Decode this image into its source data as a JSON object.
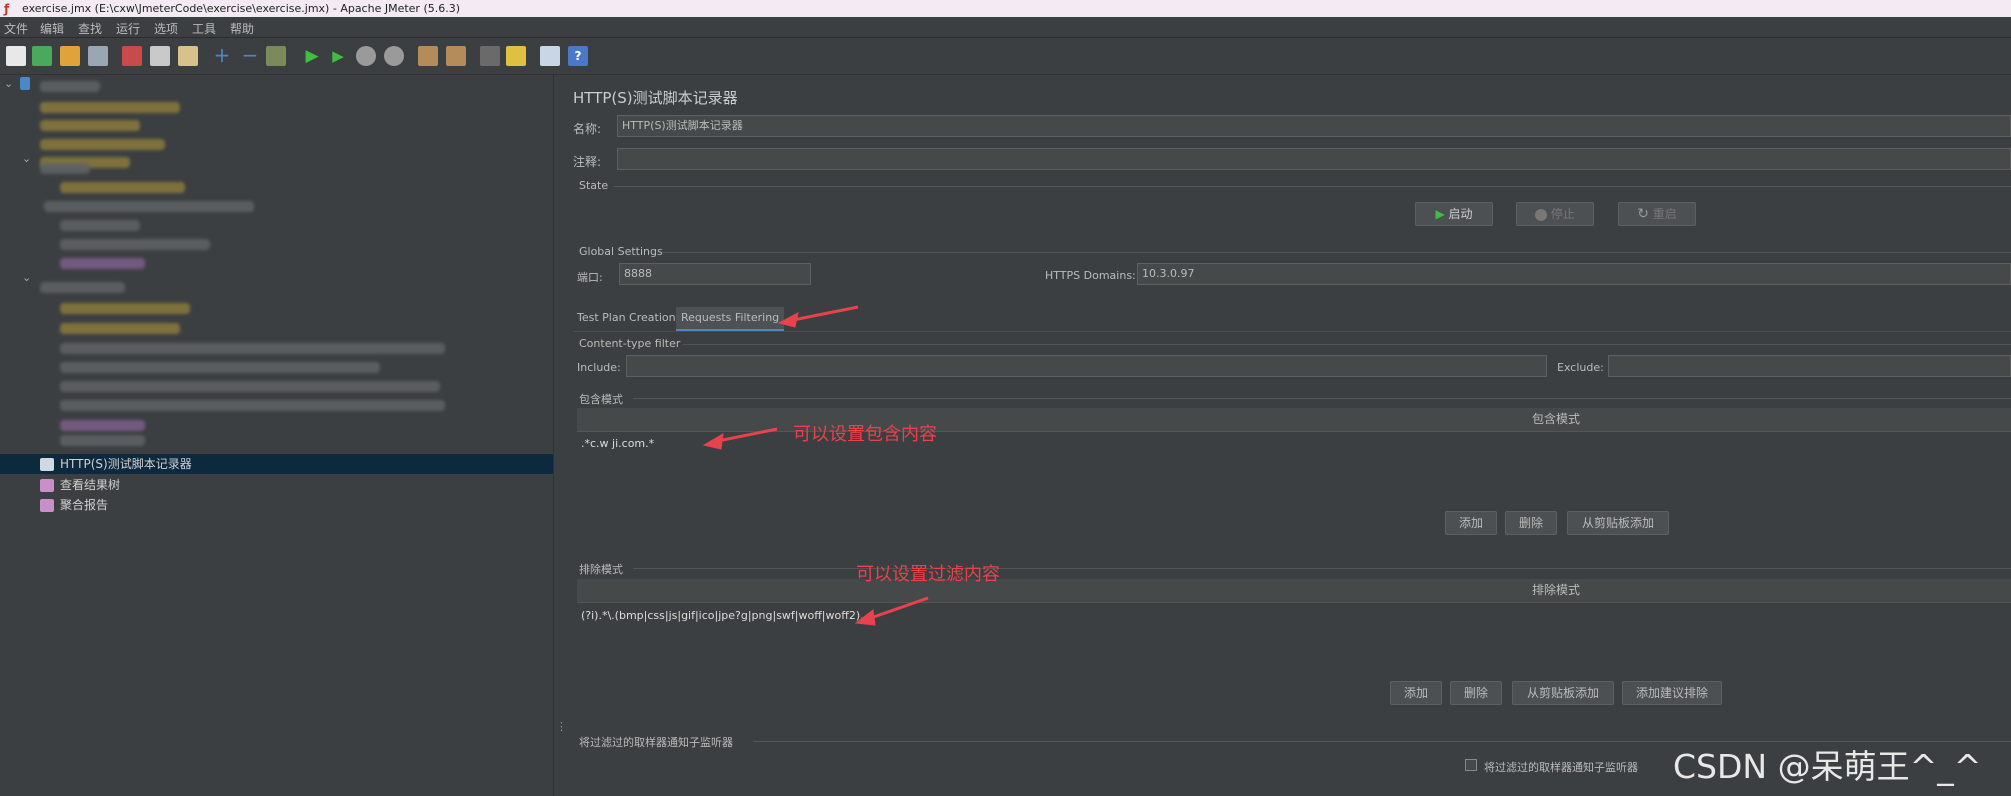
{
  "window": {
    "title": "exercise.jmx (E:\\cxw\\JmeterCode\\exercise\\exercise.jmx) - Apache JMeter (5.6.3)"
  },
  "menu": [
    "文件",
    "编辑",
    "查找",
    "运行",
    "选项",
    "工具",
    "帮助"
  ],
  "tree": {
    "items": [
      {
        "label": "HTTP(S)测试脚本记录器",
        "selected": true,
        "icon": "recorder-icon"
      },
      {
        "label": "查看结果树",
        "selected": false,
        "icon": "graph-icon"
      },
      {
        "label": "聚合报告",
        "selected": false,
        "icon": "graph-icon"
      }
    ]
  },
  "recorder": {
    "title": "HTTP(S)测试脚本记录器",
    "name_label": "名称:",
    "name_value": "HTTP(S)测试脚本记录器",
    "comment_label": "注释:",
    "comment_value": "",
    "state_section": "State",
    "start_button": "启动",
    "stop_button": "停止",
    "restart_button": "重启",
    "global_section": "Global Settings",
    "port_label": "端口:",
    "port_value": "8888",
    "https_label": "HTTPS Domains:",
    "https_value": "10.3.0.97",
    "tabs": [
      {
        "label": "Test Plan Creation",
        "active": false
      },
      {
        "label": "Requests Filtering",
        "active": true
      }
    ],
    "content_type_section": "Content-type filter",
    "include_label": "Include:",
    "include_value": "",
    "exclude_label": "Exclude:",
    "exclude_value": "",
    "include_section": "包含模式",
    "include_table_header": "包含模式",
    "include_rows": [
      ".*c.w            ji.com.*"
    ],
    "include_buttons": {
      "add": "添加",
      "delete": "删除",
      "clipboard": "从剪贴板添加"
    },
    "exclude_section": "排除模式",
    "exclude_table_header": "排除模式",
    "exclude_rows": [
      "(?i).*\\.(bmp|css|js|gif|ico|jpe?g|png|swf|woff|woff2)."
    ],
    "exclude_buttons": {
      "add": "添加",
      "delete": "删除",
      "clipboard": "从剪贴板添加",
      "suggested": "添加建议排除"
    },
    "notify_section": "将过滤过的取样器通知子监听器",
    "notify_checkbox_label": "将过滤过的取样器通知子监听器",
    "notify_checked": false
  },
  "annotations": {
    "include_note": "可以设置包含内容",
    "exclude_note": "可以设置过滤内容"
  },
  "watermark": "CSDN @呆萌王^_^",
  "colors": {
    "accent": "#4a88c7",
    "annotation": "#e8424c",
    "selection": "#0d293e",
    "background": "#3c3f41"
  }
}
